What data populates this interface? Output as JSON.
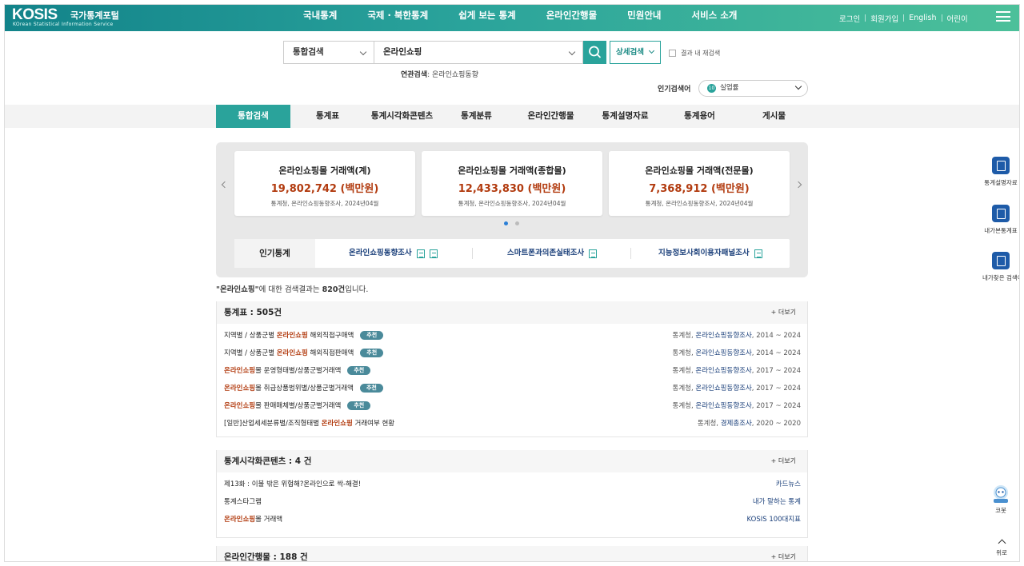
{
  "header": {
    "logo": "KOSIS",
    "logo_kr": "국가통계포털",
    "logo_sub": "KOrean Statistical Information Service",
    "nav": [
      "국내통계",
      "국제 · 북한통계",
      "쉽게 보는 통계",
      "온라인간행물",
      "민원안내",
      "서비스 소개"
    ],
    "util": [
      "로그인",
      "회원가입",
      "English",
      "어린이"
    ]
  },
  "search": {
    "scope": "통합검색",
    "query": "온라인쇼핑",
    "detail_label": "상세검색",
    "research_label": "결과 내 재검색",
    "related_label": "연관검색",
    "related_value": ": 온라인쇼핑동향",
    "popular_label": "인기검색어",
    "popular_num": "10",
    "popular_value": "실업률"
  },
  "tabs": [
    "통합검색",
    "통계표",
    "통계시각화콘텐츠",
    "통계분류",
    "온라인간행물",
    "통계설명자료",
    "통계용어",
    "게시물"
  ],
  "cards": [
    {
      "title": "온라인쇼핑몰 거래액(계)",
      "value": "19,802,742 (백만원)",
      "source": "통계청, 온라인쇼핑동향조사, 2024년04월"
    },
    {
      "title": "온라인쇼핑몰 거래액(종합몰)",
      "value": "12,433,830 (백만원)",
      "source": "통계청, 온라인쇼핑동향조사, 2024년04월"
    },
    {
      "title": "온라인쇼핑몰 거래액(전문몰)",
      "value": "7,368,912 (백만원)",
      "source": "통계청, 온라인쇼핑동향조사, 2024년04월"
    }
  ],
  "popular_stats": {
    "label": "인기통계",
    "items": [
      "온라인쇼핑동향조사",
      "스마트폰과의존실태조사",
      "지능정보사회이용자패널조사"
    ]
  },
  "summary": {
    "q": "\"온라인쇼핑\"",
    "mid": "에 대한 검색결과는 ",
    "count": "820건",
    "end": "입니다."
  },
  "more_label": "+ 더보기",
  "stat_tables": {
    "title": "통계표 : 505건",
    "badge": "추천",
    "rows": [
      {
        "pre": "지역별 / 상품군별 ",
        "hl": "온라인쇼핑",
        "post": " 해외직접구매액",
        "org": "통계청, ",
        "link": "온라인쇼핑동향조사",
        "period": ", 2014 ~ 2024",
        "badge": true
      },
      {
        "pre": "지역별 / 상품군별 ",
        "hl": "온라인쇼핑",
        "post": " 해외직접판매액",
        "org": "통계청, ",
        "link": "온라인쇼핑동향조사",
        "period": ", 2014 ~ 2024",
        "badge": true
      },
      {
        "pre": "",
        "hl": "온라인쇼핑",
        "post": "몰 운영형태별/상품군별거래액",
        "org": "통계청, ",
        "link": "온라인쇼핑동향조사",
        "period": ", 2017 ~ 2024",
        "badge": true
      },
      {
        "pre": "",
        "hl": "온라인쇼핑",
        "post": "몰 취급상품범위별/상품군별거래액",
        "org": "통계청, ",
        "link": "온라인쇼핑동향조사",
        "period": ", 2017 ~ 2024",
        "badge": true
      },
      {
        "pre": "",
        "hl": "온라인쇼핑",
        "post": "몰 판매매체별/상품군별거래액",
        "org": "통계청, ",
        "link": "온라인쇼핑동향조사",
        "period": ", 2017 ~ 2024",
        "badge": true
      },
      {
        "pre": "[일반]산업세세분류별/조직형태별 ",
        "hl": "온라인쇼핑",
        "post": " 거래여부 현황",
        "org": "통계청, ",
        "link": "경제총조사",
        "period": ", 2020 ~ 2020",
        "badge": false
      }
    ]
  },
  "visual": {
    "title": "통계시각화콘텐츠 : 4 건",
    "rows": [
      {
        "pre": "제13화 : 이불 밖은 위험해?온라인으로 싹-해결!",
        "hl": "",
        "post": "",
        "right": "카드뉴스"
      },
      {
        "pre": "통계스타그램",
        "hl": "",
        "post": "",
        "right": "내가 말하는 통계"
      },
      {
        "pre": "",
        "hl": "온라인쇼핑",
        "post": "몰 거래액",
        "right": "KOSIS 100대지표"
      }
    ]
  },
  "publications": {
    "title": "온라인간행물 : 188 건"
  },
  "quick": [
    "통계설명자료",
    "내가본통계표",
    "내가찾은 검색어"
  ],
  "bot_label": "코봇",
  "top_label": "위로",
  "colors": {
    "brand": "#2aa39b",
    "highlight": "#b23b0f",
    "link": "#1a3f7a"
  }
}
